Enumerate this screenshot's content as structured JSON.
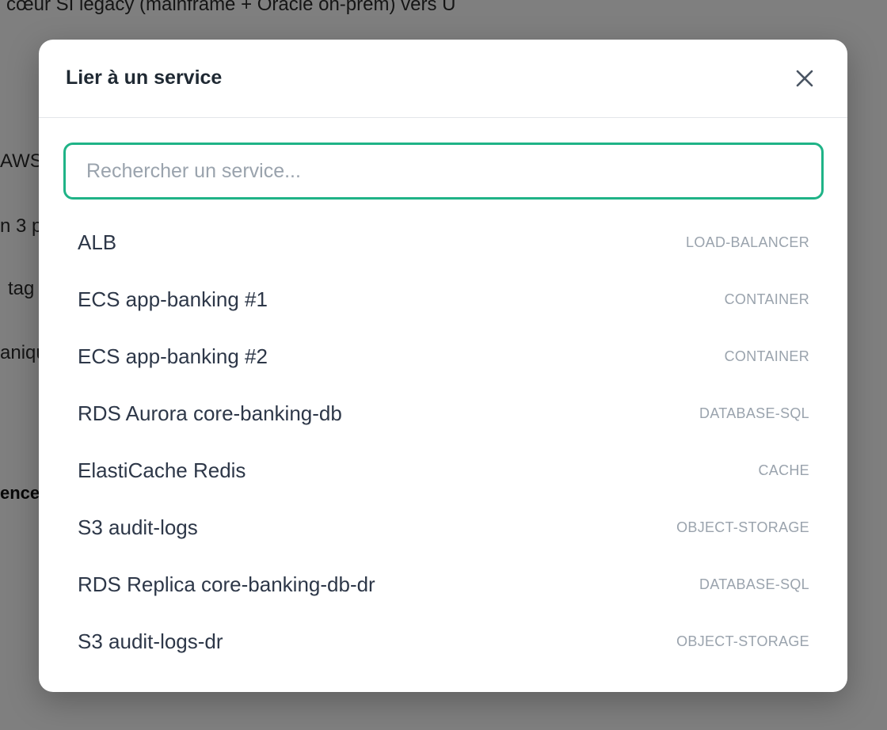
{
  "background": {
    "line1": "cœur SI legacy (mainframe + Oracle on-prem) vers U",
    "line2": "AWS",
    "line3": "n 3 p",
    "line4": "tag",
    "line5": "aniqu",
    "line6": "ence"
  },
  "modal": {
    "title": "Lier à un service",
    "close_icon": "close-icon",
    "search": {
      "placeholder": "Rechercher un service...",
      "value": ""
    },
    "services": [
      {
        "name": "ALB",
        "type": "LOAD-BALANCER"
      },
      {
        "name": "ECS app-banking #1",
        "type": "CONTAINER"
      },
      {
        "name": "ECS app-banking #2",
        "type": "CONTAINER"
      },
      {
        "name": "RDS Aurora core-banking-db",
        "type": "DATABASE-SQL"
      },
      {
        "name": "ElastiCache Redis",
        "type": "CACHE"
      },
      {
        "name": "S3 audit-logs",
        "type": "OBJECT-STORAGE"
      },
      {
        "name": "RDS Replica core-banking-db-dr",
        "type": "DATABASE-SQL"
      },
      {
        "name": "S3 audit-logs-dr",
        "type": "OBJECT-STORAGE"
      }
    ]
  },
  "colors": {
    "accent": "#1fb387",
    "overlay": "rgba(0,0,0,0.5)",
    "muted_text": "#9aa3ad"
  }
}
